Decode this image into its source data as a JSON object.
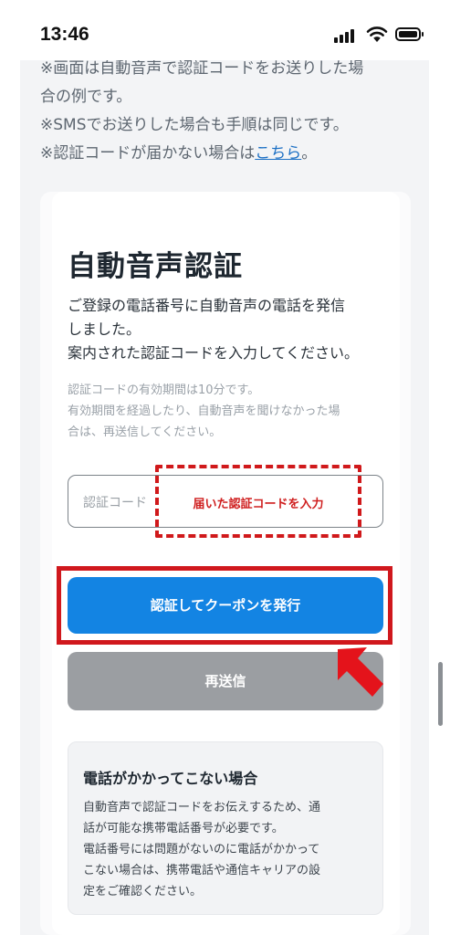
{
  "status_bar": {
    "time": "13:46"
  },
  "notes": {
    "line1": "※画面は自動音声で認証コードをお送りした場",
    "line2": "合の例です。",
    "line3": "※SMSでお送りした場合も手順は同じです。",
    "line4_prefix": "※認証コードが届かない場合は",
    "line4_link": "こちら",
    "line4_suffix": "。"
  },
  "card": {
    "title": "自動音声認証",
    "desc": [
      "ご登録の電話番号に自動音声の電話を発信",
      "しました。",
      "案内された認証コードを入力してください。"
    ],
    "sub": [
      "認証コードの有効期間は10分です。",
      "有効期間を経過したり、自動音声を聞けなかった場",
      "合は、再送信してください。"
    ],
    "code_input": {
      "placeholder": "認証コード",
      "annotation": "届いた認証コードを入力"
    },
    "primary_button": "認証してクーポンを発行",
    "resend_button": "再送信",
    "help": {
      "title": "電話がかかってこない場合",
      "lines": [
        "自動音声で認証コードをお伝えするため、通",
        "話が可能な携帯電話番号が必要です。",
        "電話番号には問題がないのに電話がかかって",
        "こない場合は、携帯電話や通信キャリアの設",
        "定をご確認ください。"
      ]
    }
  },
  "colors": {
    "accent": "#1384e3",
    "annotation_red": "#d0191b",
    "resend_gray": "#9b9ea2",
    "link": "#1b6fc4"
  },
  "icons": [
    "cellular-signal-icon",
    "wifi-icon",
    "battery-icon",
    "red-arrow-icon"
  ]
}
